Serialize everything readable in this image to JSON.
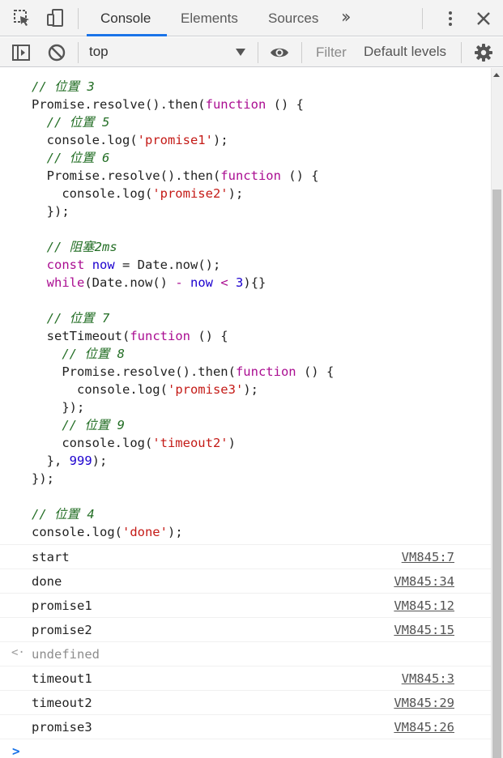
{
  "tabs": [
    {
      "label": "Console",
      "active": true
    },
    {
      "label": "Elements",
      "active": false
    },
    {
      "label": "Sources",
      "active": false
    }
  ],
  "more_tabs_icon": "double-chevron-right-icon",
  "toolbar": {
    "context": "top",
    "filter_placeholder": "Filter",
    "levels_label": "Default levels"
  },
  "code_lines": [
    [
      {
        "t": "// 位置 3",
        "c": "cm"
      }
    ],
    [
      {
        "t": "Promise.resolve().then(",
        "c": ""
      },
      {
        "t": "function",
        "c": "kw"
      },
      {
        "t": " () {",
        "c": ""
      }
    ],
    [
      {
        "t": "  ",
        "c": ""
      },
      {
        "t": "// 位置 5",
        "c": "cm"
      }
    ],
    [
      {
        "t": "  console.log(",
        "c": ""
      },
      {
        "t": "'promise1'",
        "c": "str"
      },
      {
        "t": ");",
        "c": ""
      }
    ],
    [
      {
        "t": "  ",
        "c": ""
      },
      {
        "t": "// 位置 6",
        "c": "cm"
      }
    ],
    [
      {
        "t": "  Promise.resolve().then(",
        "c": ""
      },
      {
        "t": "function",
        "c": "kw"
      },
      {
        "t": " () {",
        "c": ""
      }
    ],
    [
      {
        "t": "    console.log(",
        "c": ""
      },
      {
        "t": "'promise2'",
        "c": "str"
      },
      {
        "t": ");",
        "c": ""
      }
    ],
    [
      {
        "t": "  });",
        "c": ""
      }
    ],
    [
      {
        "t": "",
        "c": ""
      }
    ],
    [
      {
        "t": "  ",
        "c": ""
      },
      {
        "t": "// 阻塞2ms",
        "c": "cm"
      }
    ],
    [
      {
        "t": "  ",
        "c": ""
      },
      {
        "t": "const",
        "c": "kw"
      },
      {
        "t": " ",
        "c": ""
      },
      {
        "t": "now",
        "c": "var"
      },
      {
        "t": " = Date.now();",
        "c": ""
      }
    ],
    [
      {
        "t": "  ",
        "c": ""
      },
      {
        "t": "while",
        "c": "kw"
      },
      {
        "t": "(Date.now() ",
        "c": ""
      },
      {
        "t": "-",
        "c": "op"
      },
      {
        "t": " ",
        "c": ""
      },
      {
        "t": "now",
        "c": "var"
      },
      {
        "t": " ",
        "c": ""
      },
      {
        "t": "<",
        "c": "op"
      },
      {
        "t": " ",
        "c": ""
      },
      {
        "t": "3",
        "c": "var"
      },
      {
        "t": "){}",
        "c": ""
      }
    ],
    [
      {
        "t": "",
        "c": ""
      }
    ],
    [
      {
        "t": "  ",
        "c": ""
      },
      {
        "t": "// 位置 7",
        "c": "cm"
      }
    ],
    [
      {
        "t": "  setTimeout(",
        "c": ""
      },
      {
        "t": "function",
        "c": "kw"
      },
      {
        "t": " () {",
        "c": ""
      }
    ],
    [
      {
        "t": "    ",
        "c": ""
      },
      {
        "t": "// 位置 8",
        "c": "cm"
      }
    ],
    [
      {
        "t": "    Promise.resolve().then(",
        "c": ""
      },
      {
        "t": "function",
        "c": "kw"
      },
      {
        "t": " () {",
        "c": ""
      }
    ],
    [
      {
        "t": "      console.log(",
        "c": ""
      },
      {
        "t": "'promise3'",
        "c": "str"
      },
      {
        "t": ");",
        "c": ""
      }
    ],
    [
      {
        "t": "    });",
        "c": ""
      }
    ],
    [
      {
        "t": "    ",
        "c": ""
      },
      {
        "t": "// 位置 9",
        "c": "cm"
      }
    ],
    [
      {
        "t": "    console.log(",
        "c": ""
      },
      {
        "t": "'timeout2'",
        "c": "str"
      },
      {
        "t": ")",
        "c": ""
      }
    ],
    [
      {
        "t": "  }, ",
        "c": ""
      },
      {
        "t": "999",
        "c": "var"
      },
      {
        "t": ");",
        "c": ""
      }
    ],
    [
      {
        "t": "});",
        "c": ""
      }
    ],
    [
      {
        "t": "",
        "c": ""
      }
    ],
    [
      {
        "t": "// 位置 4",
        "c": "cm"
      }
    ],
    [
      {
        "t": "console.log(",
        "c": ""
      },
      {
        "t": "'done'",
        "c": "str"
      },
      {
        "t": ");",
        "c": ""
      }
    ]
  ],
  "logs": [
    {
      "text": "start",
      "source": "VM845:7",
      "type": "log"
    },
    {
      "text": "done",
      "source": "VM845:34",
      "type": "log"
    },
    {
      "text": "promise1",
      "source": "VM845:12",
      "type": "log"
    },
    {
      "text": "promise2",
      "source": "VM845:15",
      "type": "log"
    },
    {
      "text": "undefined",
      "source": "",
      "type": "result"
    },
    {
      "text": "timeout1",
      "source": "VM845:3",
      "type": "log"
    },
    {
      "text": "timeout2",
      "source": "VM845:29",
      "type": "log"
    },
    {
      "text": "promise3",
      "source": "VM845:26",
      "type": "log"
    }
  ],
  "prompt_symbol": ">",
  "result_symbol": "<·",
  "colors": {
    "accent": "#1a73e8",
    "comment": "#236e25",
    "keyword": "#aa0d91",
    "string": "#c41a16",
    "number": "#1c00cf"
  }
}
